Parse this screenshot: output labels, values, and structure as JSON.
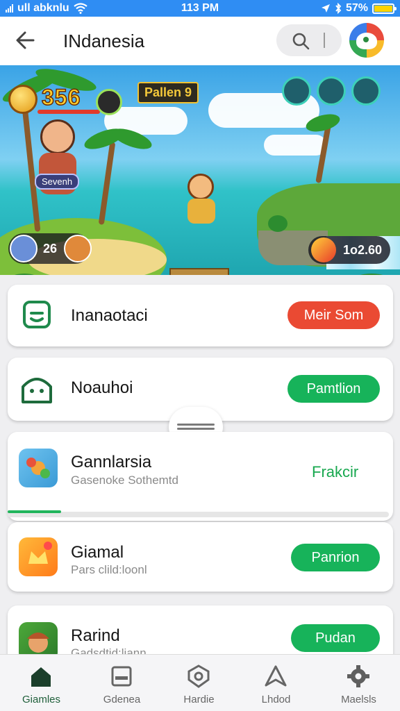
{
  "status_bar": {
    "carrier": "ull abknlu",
    "time": "113 PM",
    "battery": "57%"
  },
  "header": {
    "title": "INdanesia"
  },
  "banner": {
    "score": "356",
    "level": "Pallen 9",
    "character_tag": "Sevenh",
    "players_count": "26",
    "resource_count": "1о2.60"
  },
  "rows": [
    {
      "name": "Inanaotaci",
      "action": "Meir Som",
      "action_color": "#ea4a33"
    },
    {
      "name": "Noauhoi",
      "action": "Pamtlion",
      "action_color": "#17b35a"
    },
    {
      "name": "Gannlarsia",
      "subtitle": "Gasenoke Sothemtd",
      "action": "Frakcir",
      "progress": 0.14
    },
    {
      "name": "Giamal",
      "subtitle": "Pars clild:loonl",
      "action": "Panrion"
    },
    {
      "name": "Rarind",
      "subtitle": "Gadsdtid:liann",
      "action": "Pudan"
    }
  ],
  "bottom_nav": [
    {
      "label": "Giamles",
      "icon": "home-icon",
      "active": true
    },
    {
      "label": "Gdenea",
      "icon": "card-icon"
    },
    {
      "label": "Hardie",
      "icon": "shield-icon"
    },
    {
      "label": "Lhdod",
      "icon": "triangle-icon"
    },
    {
      "label": "Maelsls",
      "icon": "settings-gear-icon"
    }
  ]
}
